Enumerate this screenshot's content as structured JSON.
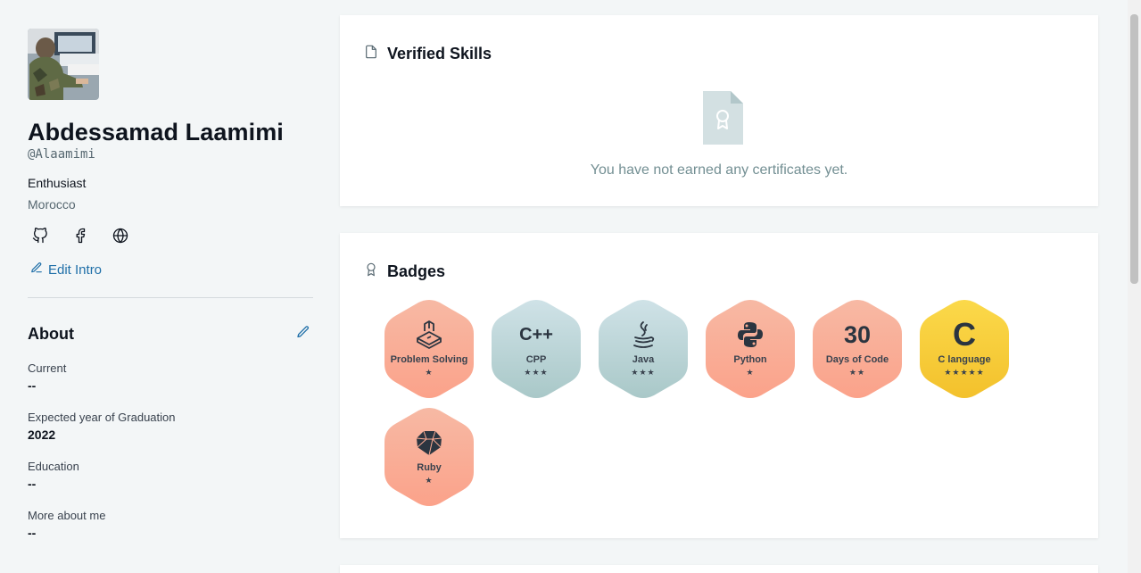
{
  "profile": {
    "name": "Abdessamad Laamimi",
    "handle": "@Alaamimi",
    "headline": "Enthusiast",
    "country": "Morocco",
    "edit_intro_label": "Edit Intro"
  },
  "about": {
    "title": "About",
    "fields": [
      {
        "label": "Current",
        "value": "--"
      },
      {
        "label": "Expected year of Graduation",
        "value": "2022"
      },
      {
        "label": "Education",
        "value": "--"
      },
      {
        "label": "More about me",
        "value": "--"
      }
    ]
  },
  "skills": {
    "title": "Verified Skills",
    "empty_text": "You have not earned any certificates yet."
  },
  "badges": {
    "title": "Badges",
    "items": [
      {
        "name": "Problem Solving",
        "stars": "★",
        "icon": "problem-solving-icon",
        "palette": "salmon"
      },
      {
        "name": "CPP",
        "stars": "★★★",
        "icon": "cpp-icon",
        "icon_text": "C++",
        "palette": "teal"
      },
      {
        "name": "Java",
        "stars": "★★★",
        "icon": "java-icon",
        "palette": "teal"
      },
      {
        "name": "Python",
        "stars": "★",
        "icon": "python-icon",
        "palette": "salmon"
      },
      {
        "name": "Days of Code",
        "stars": "★★",
        "icon": "days-of-code-icon",
        "icon_text": "30",
        "palette": "salmon"
      },
      {
        "name": "C language",
        "stars": "★★★★★",
        "icon": "c-language-icon",
        "icon_text": "C",
        "palette": "gold"
      },
      {
        "name": "Ruby",
        "stars": "★",
        "icon": "ruby-icon",
        "palette": "salmon"
      }
    ]
  },
  "colors": {
    "accent": "#1f6fa8",
    "salmon_top": "#f7b9a4",
    "salmon_bottom": "#fba28a",
    "teal_top": "#cfe2e7",
    "teal_bottom": "#a9c8c8",
    "gold_top": "#fbd94a",
    "gold_bottom": "#f3c12c"
  }
}
